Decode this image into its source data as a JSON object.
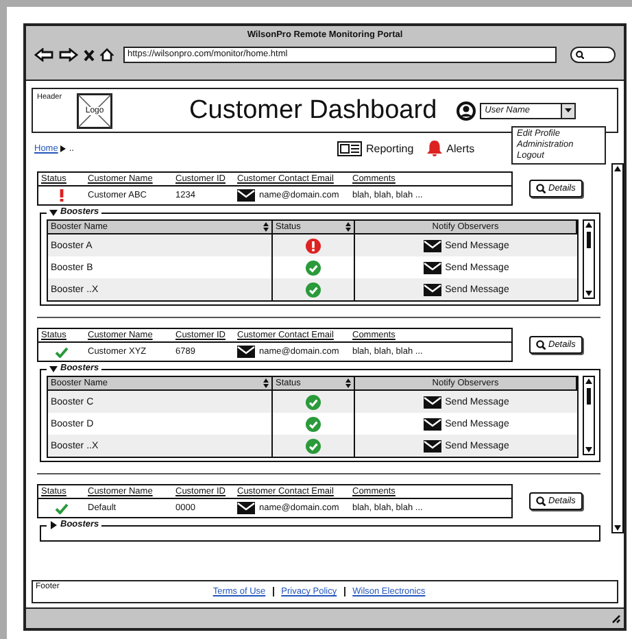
{
  "browser": {
    "title": "WilsonPro Remote Monitoring Portal",
    "url": "https://wilsonpro.com/monitor/home.html"
  },
  "header": {
    "label": "Header",
    "logo": "Logo",
    "title": "Customer Dashboard",
    "user_menu": {
      "value": "User Name",
      "expanded": true,
      "items": [
        "Edit Profile",
        "Administration",
        "Logout"
      ]
    }
  },
  "breadcrumb": [
    "Home",
    ".."
  ],
  "nav": [
    {
      "label": "Reporting",
      "kind": "report"
    },
    {
      "label": "Alerts",
      "kind": "alert"
    }
  ],
  "customers": [
    {
      "columns": [
        "Status",
        "Customer Name",
        "Customer ID",
        "Customer Contact Email",
        "Comments"
      ],
      "alert": true,
      "name": "Customer ABC",
      "id": "1234",
      "email": "name@domain.com",
      "comments": "blah, blah, blah ...",
      "details": "Details",
      "boosters": {
        "label": "Boosters",
        "expanded": true,
        "columns": [
          "Booster Name",
          "Status",
          "Notify Observers"
        ],
        "rows": [
          {
            "name": "Booster A",
            "alert": true,
            "action": "Send Message"
          },
          {
            "name": "Booster B",
            "alert": false,
            "action": "Send Message"
          },
          {
            "name": "Booster ..X",
            "alert": false,
            "action": "Send Message"
          }
        ]
      }
    },
    {
      "columns": [
        "Status",
        "Customer Name",
        "Customer ID",
        "Customer Contact Email",
        "Comments"
      ],
      "alert": false,
      "name": "Customer XYZ",
      "id": "6789",
      "email": "name@domain.com",
      "comments": "blah, blah, blah ...",
      "details": "Details",
      "boosters": {
        "label": "Boosters",
        "expanded": true,
        "columns": [
          "Booster Name",
          "Status",
          "Notify Observers"
        ],
        "rows": [
          {
            "name": "Booster C",
            "alert": false,
            "action": "Send Message"
          },
          {
            "name": "Booster D",
            "alert": false,
            "action": "Send Message"
          },
          {
            "name": "Booster ..X",
            "alert": false,
            "action": "Send Message"
          }
        ]
      }
    },
    {
      "columns": [
        "Status",
        "Customer Name",
        "Customer ID",
        "Customer Contact Email",
        "Comments"
      ],
      "alert": false,
      "name": "Default",
      "id": "0000",
      "email": "name@domain.com",
      "comments": "blah, blah, blah ...",
      "details": "Details",
      "boosters": {
        "label": "Boosters",
        "expanded": false
      }
    }
  ],
  "footer": {
    "label": "Footer",
    "links": [
      "Terms of Use",
      "Privacy Policy",
      "Wilson Electronics"
    ]
  }
}
